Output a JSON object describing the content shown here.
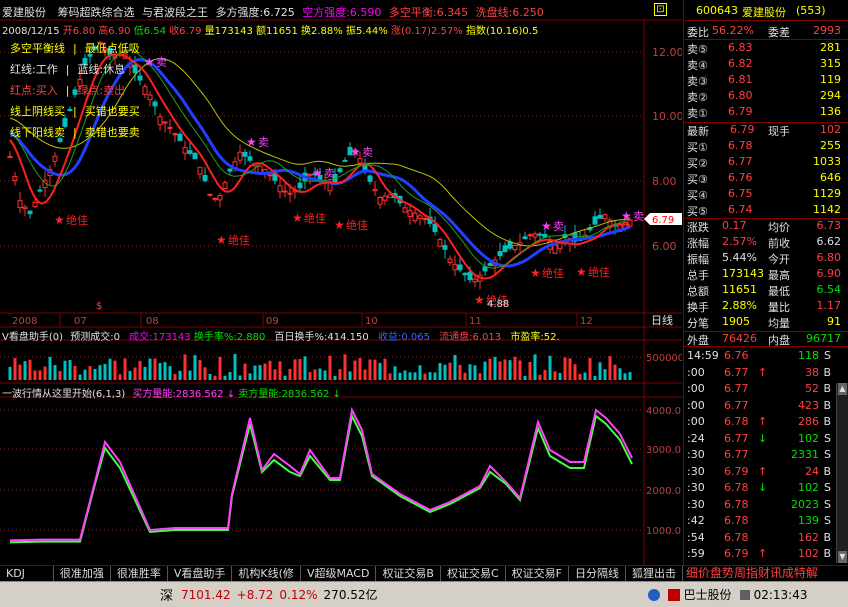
{
  "header": {
    "title": "爱建股份",
    "formula": "筹码超跌综合选",
    "formula2": "与君波段之王",
    "strength_long": "多方强度:6.725",
    "strength_short": "空方强度:6.590",
    "balance": "多空平衡:6.345",
    "wash": "洗盘线:6.250"
  },
  "quote_line": {
    "date": "2008/12/15",
    "open": "开6.80",
    "high": "高6.90",
    "low": "低6.54",
    "close": "收6.79",
    "vol": "量173143",
    "amount": "额11651",
    "turnover": "换2.88%",
    "amplitude": "振5.44%",
    "change": "涨(0.17)2.57%",
    "index": "指数(10.16)0.5"
  },
  "legend_items": [
    {
      "text": "多空平衡线",
      "sep": "|",
      "text2": "最低点低吸",
      "color": "#ffff00",
      "color2": "#ffff00"
    },
    {
      "text": "红线:工作",
      "sep": "|",
      "text2": "蓝线:休息",
      "color": "#e0e0e0",
      "color2": "#e0e0e0"
    },
    {
      "text": "红点:买入",
      "sep": "|",
      "text2": "绿点:卖出",
      "color": "#ff4040",
      "color2": "#ff4040"
    },
    {
      "text": "线上阴线买",
      "sep": "|",
      "text2": "买错也要买",
      "color": "#ffff00",
      "color2": "#ffff00"
    },
    {
      "text": "线下阳线卖",
      "sep": "|",
      "text2": "卖错也要卖",
      "color": "#ffff00",
      "color2": "#ffff00"
    }
  ],
  "price_axis": [
    "12.00",
    "10.00",
    "8.00",
    "6.00"
  ],
  "price_tag": "6.79",
  "month_labels": [
    "2008",
    "07",
    "08",
    "09",
    "10",
    "11",
    "12"
  ],
  "chart_annotations": {
    "sell": "卖",
    "buy": "绝佳",
    "low_price": "4.88",
    "mark": "$"
  },
  "period": "日线",
  "vol_header": {
    "name": "V看盘助手(0)",
    "predict": "预测成交:0",
    "deal": "成交:173143",
    "turnover": "换手率%:2.880",
    "hundred": "百日换手%:414.150",
    "profit": "收益:0.065",
    "float": "流通盘:6.013",
    "pe": "市盈率:52."
  },
  "vol_axis": "500000",
  "ind_header": {
    "name": "一波行情从这里开始(6,1,3)",
    "buy": "买方量能:2836.562",
    "sell": "卖方量能:2836.562"
  },
  "ind_axis": [
    "4000.0",
    "3000.0",
    "2000.0",
    "1000.0"
  ],
  "tabs": [
    "KDJ",
    "很准加强",
    "很准胜率",
    "V看盘助手",
    "机构K线(修",
    "V超级MACD",
    "权证交易B",
    "权证交易C",
    "权证交易F",
    "日分隔线",
    "狐狸出击"
  ],
  "tabs_right": "细价盘势周指财讯成特解",
  "status": {
    "market": "深",
    "index": "7101.42",
    "change": "+8.72",
    "pct": "0.12%",
    "amount": "270.52亿",
    "stock": "巴士股份",
    "time": "02:13:43"
  },
  "right": {
    "code": "600643",
    "name": "爱建股份",
    "count": "(553)",
    "weibi_label": "委比",
    "weibi": "56.22%",
    "weicha_label": "委差",
    "weicha": "2993",
    "sells": [
      {
        "label": "卖⑤",
        "price": "6.83",
        "vol": "281"
      },
      {
        "label": "卖④",
        "price": "6.82",
        "vol": "315"
      },
      {
        "label": "卖③",
        "price": "6.81",
        "vol": "119"
      },
      {
        "label": "卖②",
        "price": "6.80",
        "vol": "294"
      },
      {
        "label": "卖①",
        "price": "6.79",
        "vol": "136"
      }
    ],
    "latest_label": "最新",
    "latest": "6.79",
    "xianshou_label": "现手",
    "xianshou": "102",
    "buys": [
      {
        "label": "买①",
        "price": "6.78",
        "vol": "255"
      },
      {
        "label": "买②",
        "price": "6.77",
        "vol": "1033"
      },
      {
        "label": "买③",
        "price": "6.76",
        "vol": "646"
      },
      {
        "label": "买④",
        "price": "6.75",
        "vol": "1129"
      },
      {
        "label": "买⑤",
        "price": "6.74",
        "vol": "1142"
      }
    ],
    "stats": [
      {
        "l1": "涨跌",
        "v1": "0.17",
        "l2": "均价",
        "v2": "6.73",
        "c1": "#ff4040",
        "c2": "#ff4040"
      },
      {
        "l1": "涨幅",
        "v1": "2.57%",
        "l2": "前收",
        "v2": "6.62",
        "c1": "#ff4040",
        "c2": "#e0e0e0"
      },
      {
        "l1": "振幅",
        "v1": "5.44%",
        "l2": "今开",
        "v2": "6.80",
        "c1": "#e0e0e0",
        "c2": "#ff4040"
      },
      {
        "l1": "总手",
        "v1": "173143",
        "l2": "最高",
        "v2": "6.90",
        "c1": "#ffff00",
        "c2": "#ff4040"
      },
      {
        "l1": "总额",
        "v1": "11651",
        "l2": "最低",
        "v2": "6.54",
        "c1": "#ffff00",
        "c2": "#00e000"
      },
      {
        "l1": "换手",
        "v1": "2.88%",
        "l2": "量比",
        "v2": "1.17",
        "c1": "#ffff00",
        "c2": "#ff4040"
      },
      {
        "l1": "分笔",
        "v1": "1905",
        "l2": "均量",
        "v2": "91",
        "c1": "#ffff00",
        "c2": "#ffff00"
      }
    ],
    "waipan_label": "外盘",
    "waipan": "76426",
    "neipan_label": "内盘",
    "neipan": "96717",
    "ticks": [
      {
        "t": "14:59",
        "p": "6.76",
        "v": "118",
        "s": "S",
        "arrow": ""
      },
      {
        "t": ":00",
        "p": "6.77",
        "v": "38",
        "s": "B",
        "arrow": "↑"
      },
      {
        "t": ":00",
        "p": "6.77",
        "v": "52",
        "s": "B",
        "arrow": ""
      },
      {
        "t": ":00",
        "p": "6.77",
        "v": "423",
        "s": "B",
        "arrow": ""
      },
      {
        "t": ":00",
        "p": "6.78",
        "v": "286",
        "s": "B",
        "arrow": "↑"
      },
      {
        "t": ":24",
        "p": "6.77",
        "v": "102",
        "s": "S",
        "arrow": "↓"
      },
      {
        "t": ":30",
        "p": "6.77",
        "v": "2331",
        "s": "S",
        "arrow": ""
      },
      {
        "t": ":30",
        "p": "6.79",
        "v": "24",
        "s": "B",
        "arrow": "↑"
      },
      {
        "t": ":30",
        "p": "6.78",
        "v": "102",
        "s": "S",
        "arrow": "↓"
      },
      {
        "t": ":30",
        "p": "6.78",
        "v": "2023",
        "s": "S",
        "arrow": ""
      },
      {
        "t": ":42",
        "p": "6.78",
        "v": "139",
        "s": "S",
        "arrow": ""
      },
      {
        "t": ":54",
        "p": "6.78",
        "v": "162",
        "s": "B",
        "arrow": ""
      },
      {
        "t": ":59",
        "p": "6.79",
        "v": "102",
        "s": "B",
        "arrow": "↑"
      }
    ]
  }
}
